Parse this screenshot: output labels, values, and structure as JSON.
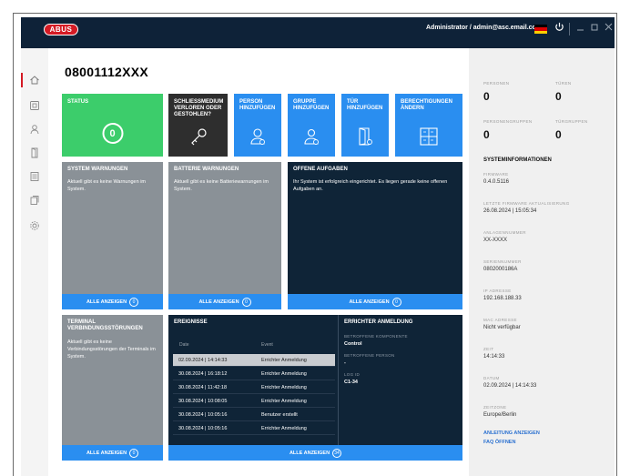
{
  "header": {
    "logo": "ABUS",
    "user": "Administrator / admin@asc.email.com",
    "flag_colors": [
      "#000000",
      "#dd0000",
      "#ffce00"
    ]
  },
  "sidebar": {
    "items": [
      {
        "icon": "home-icon"
      },
      {
        "icon": "devices-icon"
      },
      {
        "icon": "user-icon"
      },
      {
        "icon": "door-icon"
      },
      {
        "icon": "list-icon"
      },
      {
        "icon": "copy-icon"
      },
      {
        "icon": "settings-icon"
      }
    ]
  },
  "main": {
    "code": "08001112XXX",
    "tiles": {
      "status": {
        "title": "STATUS",
        "value": "0"
      },
      "lost": {
        "title": "SCHLIESSMEDIUM VERLOREN ODER GESTOHLEN?"
      },
      "add_person": {
        "title": "PERSON HINZUFÜGEN"
      },
      "add_group": {
        "title": "GRUPPE HINZUFÜGEN"
      },
      "add_door": {
        "title": "TÜR HINZUFÜGEN"
      },
      "change_perm": {
        "title": "BERECHTIGUNGEN ÄNDERN"
      }
    },
    "warnings": {
      "title": "SYSTEM WARNUNGEN",
      "text": "Aktuell gibt es keine Warnungen im System.",
      "footer": "ALLE ANZEIGEN",
      "count": "0"
    },
    "battery": {
      "title": "BATTERIE WARNUNGEN",
      "text": "Aktuell gibt es keine Batteriewarnungen im System.",
      "footer": "ALLE ANZEIGEN",
      "count": "0"
    },
    "tasks": {
      "title": "OFFENE AUFGABEN",
      "text": "Ihr System ist erfolgreich eingerichtet. Es liegen gerade keine offenen Aufgaben an.",
      "footer": "ALLE ANZEIGEN",
      "count": "0"
    },
    "terminal": {
      "title": "TERMINAL VERBINDUNGSSTÖRUNGEN",
      "text": "Aktuell gibt es keine Verbindungsstörungen der Terminals im System.",
      "footer": "ALLE ANZEIGEN",
      "count": "0"
    },
    "events": {
      "title": "EREIGNISSE",
      "col_date": "Date",
      "col_event": "Event",
      "rows": [
        {
          "date": "02.09.2024 | 14:14:33",
          "event": "Errichter Anmeldung"
        },
        {
          "date": "30.08.2024 | 16:18:12",
          "event": "Errichter Anmeldung"
        },
        {
          "date": "30.08.2024 | 11:42:18",
          "event": "Errichter Anmeldung"
        },
        {
          "date": "30.08.2024 | 10:08:05",
          "event": "Errichter Anmeldung"
        },
        {
          "date": "30.08.2024 | 10:05:16",
          "event": "Benutzer erstellt"
        },
        {
          "date": "30.08.2024 | 10:05:16",
          "event": "Errichter Anmeldung"
        }
      ],
      "footer": "ALLE ANZEIGEN",
      "count": "34"
    },
    "errichter": {
      "title": "ERRICHTER ANMELDUNG",
      "component_label": "BETROFFENE KOMPONENTE",
      "component_value": "Control",
      "person_label": "BETROFFENE PERSON",
      "person_value": "-",
      "log_label": "LOG ID",
      "log_value": "C1-34"
    }
  },
  "right_panel": {
    "personen_label": "PERSONEN",
    "personen_value": "0",
    "tueren_label": "TÜREN",
    "tueren_value": "0",
    "personengruppen_label": "PERSONENGRUPPEN",
    "personengruppen_value": "0",
    "tuergruppen_label": "TÜRGRUPPEN",
    "tuergruppen_value": "0",
    "sys_title": "SYSTEMINFORMATIONEN",
    "fields": [
      {
        "label": "FIRMWARE",
        "value": "0.4.0.5116"
      },
      {
        "label": "LETZTE FIRMWARE AKTUALISIERUNG",
        "value": "26.08.2024 | 15:05:34"
      },
      {
        "label": "ANLAGENNUMMER",
        "value": "XX-XXXX"
      },
      {
        "label": "SERIENNUMMER",
        "value": "0802000186A"
      },
      {
        "label": "IP ADRESSE",
        "value": "192.168.188.33"
      },
      {
        "label": "MAC ADRESSE",
        "value": "Nicht verfügbar"
      },
      {
        "label": "ZEIT",
        "value": "14:14:33"
      },
      {
        "label": "DATUM",
        "value": "02.09.2024 | 14:14:33"
      },
      {
        "label": "ZEITZONE",
        "value": "Europe/Berlin"
      }
    ],
    "link_manual": "ANLEITUNG ANZEIGEN",
    "link_faq": "FAQ ÖFFNEN"
  }
}
